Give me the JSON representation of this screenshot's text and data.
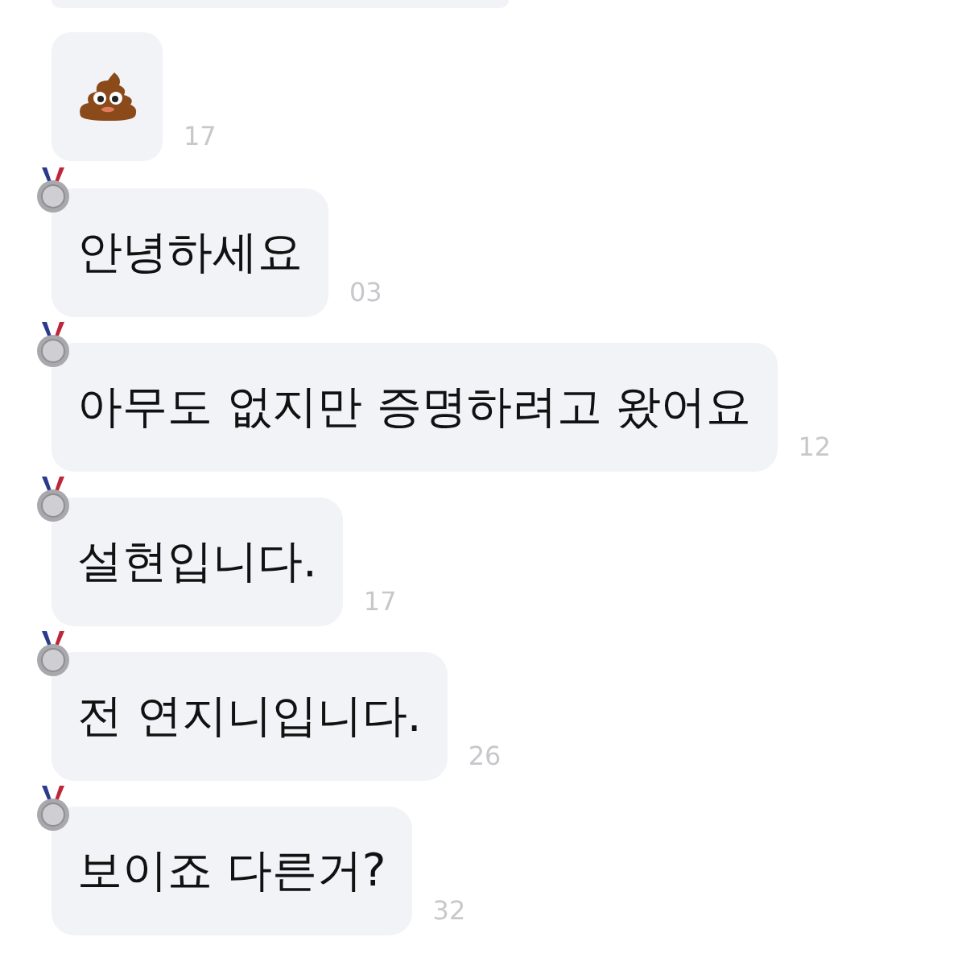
{
  "messages": [
    {
      "kind": "partial"
    },
    {
      "kind": "sticker",
      "time": "17",
      "medal": false
    },
    {
      "kind": "text",
      "text": "안녕하세요",
      "time": "03",
      "medal": true
    },
    {
      "kind": "text",
      "text": "아무도 없지만 증명하려고 왔어요",
      "time": "12",
      "medal": true
    },
    {
      "kind": "text",
      "text": "설현입니다.",
      "time": "17",
      "medal": true
    },
    {
      "kind": "text",
      "text": "전 연지니입니다.",
      "time": "26",
      "medal": true
    },
    {
      "kind": "text",
      "text": "보이죠 다른거?",
      "time": "32",
      "medal": true
    }
  ]
}
